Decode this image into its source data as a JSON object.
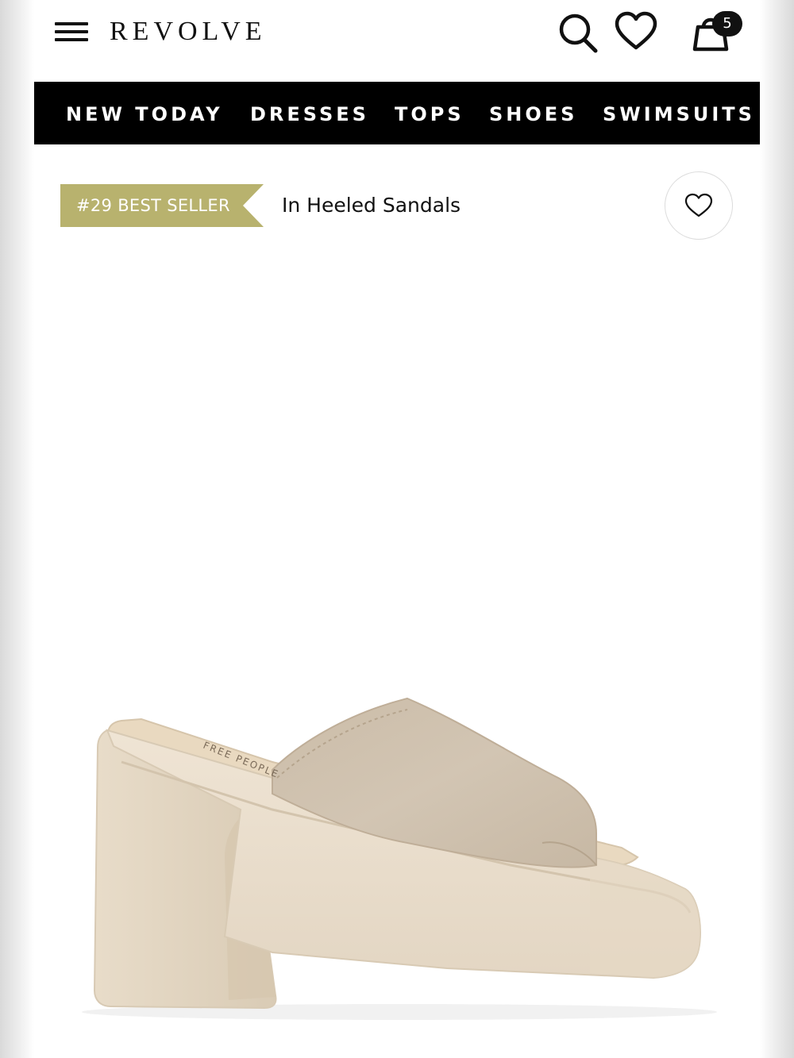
{
  "header": {
    "logo": "REVOLVE",
    "cart_count": "5",
    "icons": [
      "menu-icon",
      "search-icon",
      "heart-icon",
      "shopping-bag-icon"
    ]
  },
  "nav": {
    "items": [
      {
        "label": "NEW TODAY"
      },
      {
        "label": "DRESSES"
      },
      {
        "label": "TOPS"
      },
      {
        "label": "SHOES"
      },
      {
        "label": "SWIMSUITS"
      }
    ]
  },
  "product": {
    "badge": "#29 BEST SELLER",
    "badge_category": "In Heeled Sandals",
    "image_alt": "Beige suede platform mule sandal",
    "insole_text": "FREE PEOPLE"
  },
  "colors": {
    "badge_bg": "#b8b26e",
    "nav_bg": "#000000",
    "sole": "#ece0cf",
    "suede": "#cfc2b0"
  }
}
